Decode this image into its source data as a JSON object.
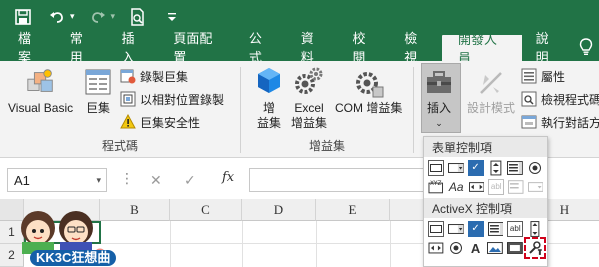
{
  "qat": {
    "icons": [
      "save-icon",
      "undo-icon",
      "redo-icon",
      "print-preview-icon",
      "customize-icon"
    ]
  },
  "tabs": [
    {
      "label": "檔案"
    },
    {
      "label": "常用"
    },
    {
      "label": "插入"
    },
    {
      "label": "頁面配置"
    },
    {
      "label": "公式"
    },
    {
      "label": "資料"
    },
    {
      "label": "校閱"
    },
    {
      "label": "檢視"
    },
    {
      "label": "開發人員",
      "active": true
    },
    {
      "label": "說明"
    }
  ],
  "ribbon": {
    "code_group": {
      "label": "程式碼",
      "visual_basic": "Visual Basic",
      "macros": "巨集",
      "record_macro": "錄製巨集",
      "relative_ref": "以相對位置錄製",
      "macro_security": "巨集安全性"
    },
    "addins_group": {
      "label": "增益集",
      "addins_line1": "增",
      "addins_line2": "益集",
      "excel_addins_line1": "Excel",
      "excel_addins_line2": "增益集",
      "com_addins": "COM 增益集"
    },
    "controls_group": {
      "insert": "插入",
      "design_mode": "設計模式",
      "properties": "屬性",
      "view_code": "檢視程式碼",
      "run_dialog": "執行對話方"
    }
  },
  "formula_bar": {
    "name_box": "A1",
    "fx_label": "fx"
  },
  "grid": {
    "columns": [
      "B",
      "C",
      "D",
      "E",
      "H"
    ],
    "rows": [
      "1",
      "2"
    ]
  },
  "gallery": {
    "form_controls_header": "表單控制項",
    "activex_header": "ActiveX 控制項"
  },
  "watermark": {
    "text": "KK3C狂想曲"
  },
  "colors": {
    "excel_green": "#217346",
    "ribbon_bg": "#f3f3f3",
    "highlight_red": "#d0021b"
  }
}
